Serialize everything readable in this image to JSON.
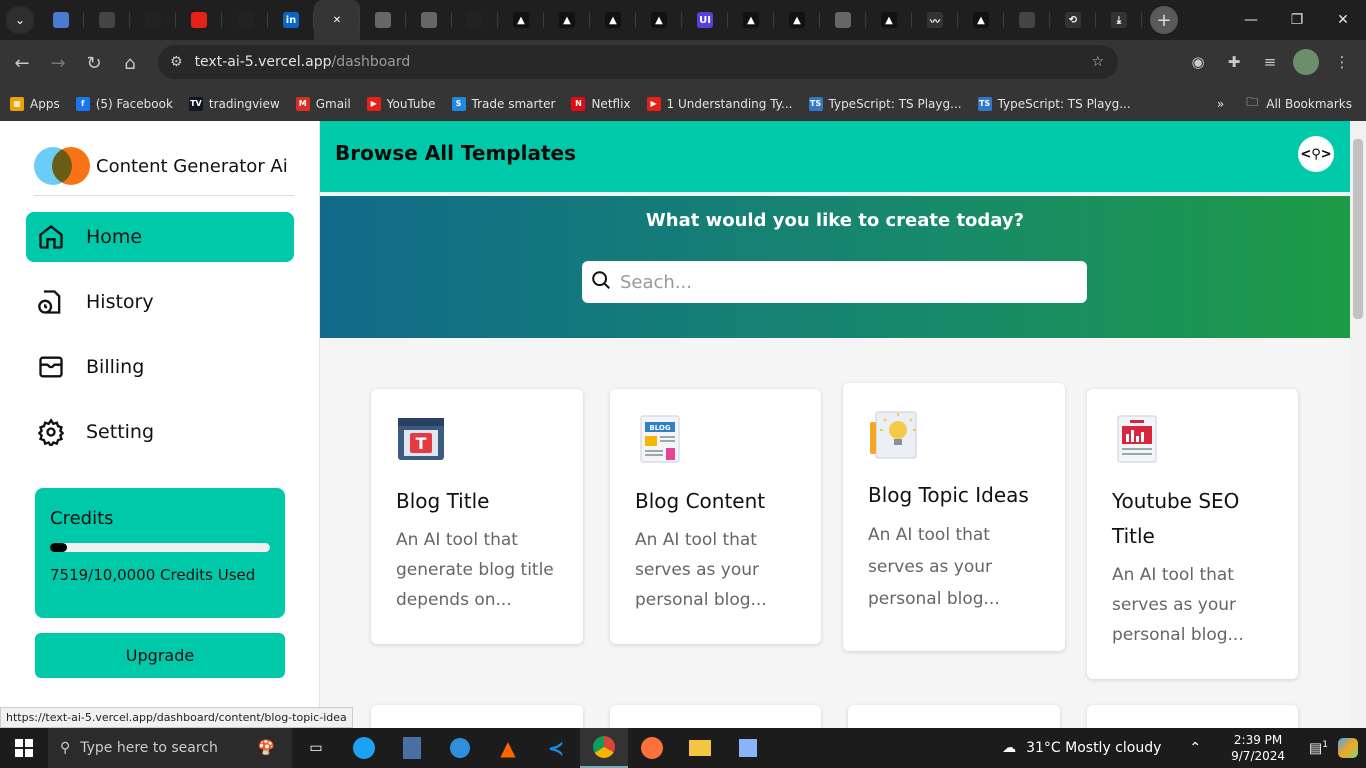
{
  "browser": {
    "tabs": [
      {
        "icon": "chrome-icon",
        "color": "#4a7bd0",
        "label": ""
      },
      {
        "icon": "openai-icon",
        "color": "#444",
        "label": ""
      },
      {
        "icon": "github-icon",
        "color": "#222",
        "label": ""
      },
      {
        "icon": "youtube-icon",
        "color": "#e62117",
        "label": ""
      },
      {
        "icon": "github-icon",
        "color": "#222",
        "label": ""
      },
      {
        "icon": "linkedin-icon",
        "color": "#0a66c2",
        "label": "in"
      },
      {
        "icon": "close-icon",
        "color": "#353535",
        "label": "✕"
      },
      {
        "icon": "globe-icon",
        "color": "#666",
        "label": ""
      },
      {
        "icon": "globe-icon",
        "color": "#666",
        "label": ""
      },
      {
        "icon": "github-icon",
        "color": "#222",
        "label": ""
      },
      {
        "icon": "vercel-icon",
        "color": "#111",
        "label": "▲"
      },
      {
        "icon": "vercel-icon",
        "color": "#111",
        "label": "▲"
      },
      {
        "icon": "vercel-icon",
        "color": "#111",
        "label": "▲"
      },
      {
        "icon": "vercel-icon",
        "color": "#111",
        "label": "▲"
      },
      {
        "icon": "ui-icon",
        "color": "#5b3fd6",
        "label": "UI"
      },
      {
        "icon": "vercel-icon",
        "color": "#111",
        "label": "▲"
      },
      {
        "icon": "vercel-icon",
        "color": "#111",
        "label": "▲"
      },
      {
        "icon": "globe-icon",
        "color": "#666",
        "label": ""
      },
      {
        "icon": "vercel-icon",
        "color": "#111",
        "label": "▲"
      },
      {
        "icon": "chart-icon",
        "color": "#333",
        "label": "〰"
      },
      {
        "icon": "vercel-icon",
        "color": "#111",
        "label": "▲"
      },
      {
        "icon": "openai-icon",
        "color": "#444",
        "label": ""
      },
      {
        "icon": "history-icon",
        "color": "#333",
        "label": "⟲"
      },
      {
        "icon": "download-icon",
        "color": "#333",
        "label": "⤓"
      }
    ],
    "url_host": "text-ai-5.vercel.app",
    "url_path": "/dashboard",
    "bookmarks": [
      {
        "label": "Apps",
        "color": "#e8a400",
        "glyph": "▦"
      },
      {
        "label": "(5) Facebook",
        "color": "#1877f2",
        "glyph": "f"
      },
      {
        "label": "tradingview",
        "color": "#131722",
        "glyph": "TV"
      },
      {
        "label": "Gmail",
        "color": "#d93025",
        "glyph": "M"
      },
      {
        "label": "YouTube",
        "color": "#e62117",
        "glyph": "▶"
      },
      {
        "label": "Trade smarter",
        "color": "#1e88e5",
        "glyph": "S"
      },
      {
        "label": "Netflix",
        "color": "#e50914",
        "glyph": "N"
      },
      {
        "label": "1 Understanding Ty...",
        "color": "#e62117",
        "glyph": "▶"
      },
      {
        "label": "TypeScript: TS Playg...",
        "color": "#3178c6",
        "glyph": "TS"
      },
      {
        "label": "TypeScript: TS Playg...",
        "color": "#3178c6",
        "glyph": "TS"
      }
    ],
    "all_bookmarks": "All Bookmarks",
    "status_url": "https://text-ai-5.vercel.app/dashboard/content/blog-topic-idea"
  },
  "sidebar": {
    "app_name": "Content Generator Ai",
    "nav": [
      {
        "label": "Home",
        "icon": "home-icon",
        "active": true
      },
      {
        "label": "History",
        "icon": "history-file-icon",
        "active": false
      },
      {
        "label": "Billing",
        "icon": "wallet-icon",
        "active": false
      },
      {
        "label": "Setting",
        "icon": "gear-icon",
        "active": false
      }
    ],
    "credits_title": "Credits",
    "credits_used_fraction": 0.075,
    "credits_text": "7519/10,0000 Credits Used",
    "upgrade_label": "Upgrade"
  },
  "header": {
    "title": "Browse All Templates"
  },
  "hero": {
    "question": "What would you like to create today?",
    "search_placeholder": "Seach..."
  },
  "templates": [
    {
      "title": "Blog Title",
      "desc": "An AI tool that generate blog title depends on...",
      "icon": "blog-title-icon"
    },
    {
      "title": "Blog Content",
      "desc": "An AI tool that serves as your personal blog...",
      "icon": "blog-content-icon"
    },
    {
      "title": "Blog Topic Ideas",
      "desc": "An AI tool that serves as your personal blog...",
      "icon": "lightbulb-icon"
    },
    {
      "title": "Youtube SEO Title",
      "desc": "An AI tool that serves as your personal blog...",
      "icon": "youtube-seo-icon"
    }
  ],
  "taskbar": {
    "search_placeholder": "Type here to search",
    "weather": "31°C  Mostly cloudy",
    "time": "2:39 PM",
    "date": "9/7/2024",
    "notification_count": "1"
  }
}
